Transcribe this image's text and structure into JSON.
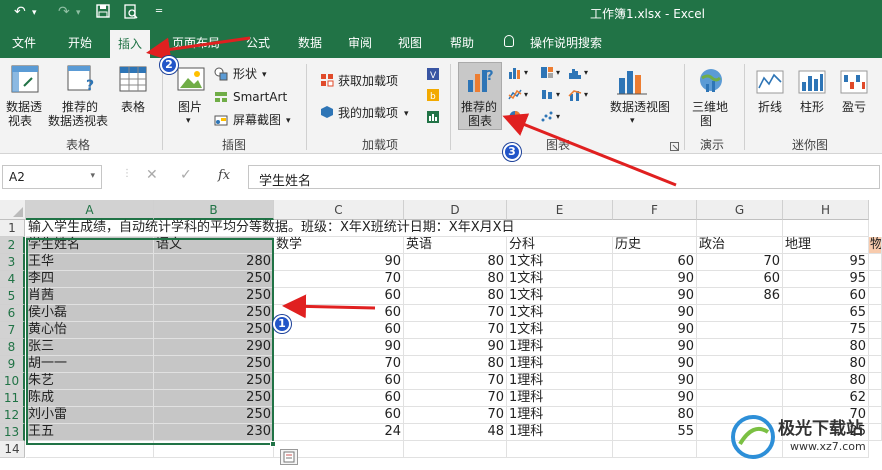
{
  "window": {
    "title": "工作簿1.xlsx  -  Excel"
  },
  "tabs": [
    "文件",
    "开始",
    "插入",
    "页面布局",
    "公式",
    "数据",
    "审阅",
    "视图",
    "帮助",
    "操作说明搜索"
  ],
  "ribbon": {
    "tables": {
      "pivot_label1": "数据透",
      "pivot_label2": "视表",
      "rec_pivot_label1": "推荐的",
      "rec_pivot_label2": "数据透视表",
      "table_label": "表格",
      "group": "表格"
    },
    "illustrations": {
      "pictures_label": "图片",
      "shapes_label": "形状",
      "smartart_label": "SmartArt",
      "screenshot_label": "屏幕截图",
      "group": "插图"
    },
    "addins": {
      "get_label": "获取加载项",
      "my_label": "我的加载项",
      "group": "加载项"
    },
    "charts": {
      "recommended_label1": "推荐的",
      "recommended_label2": "图表",
      "pivotchart_label": "数据透视图",
      "group": "图表"
    },
    "tours": {
      "map3d_label1": "三维地",
      "map3d_label2": "图",
      "group": "演示"
    },
    "sparklines": {
      "line_label": "折线",
      "column_label": "柱形",
      "winloss_label": "盈亏",
      "group": "迷你图"
    }
  },
  "formula_bar": {
    "name_box": "A2",
    "fx_label": "fx",
    "content": "学生姓名"
  },
  "grid": {
    "columns": [
      "A",
      "B",
      "C",
      "D",
      "E",
      "F",
      "G",
      "H"
    ],
    "rows": [
      "1",
      "2",
      "3",
      "4",
      "5",
      "6",
      "7",
      "8",
      "9",
      "10",
      "11",
      "12",
      "13",
      "14"
    ],
    "row1_text": "输入学生成绩，自动统计学科的平均分等数据。班级：X年X班统计日期：X年X月X日",
    "headers": [
      "学生姓名",
      "语文",
      "数学",
      "英语",
      "分科",
      "历史",
      "政治",
      "地理",
      "物"
    ],
    "data": [
      [
        "王华",
        "280",
        "90",
        "80",
        "1文科",
        "60",
        "70",
        "95"
      ],
      [
        "李四",
        "250",
        "70",
        "80",
        "1文科",
        "90",
        "60",
        "95"
      ],
      [
        "肖茜",
        "250",
        "60",
        "80",
        "1文科",
        "90",
        "86",
        "60"
      ],
      [
        "侯小磊",
        "250",
        "60",
        "70",
        "1文科",
        "90",
        "",
        "65"
      ],
      [
        "黄心怡",
        "250",
        "60",
        "70",
        "1文科",
        "90",
        "",
        "75"
      ],
      [
        "张三",
        "290",
        "90",
        "90",
        "1理科",
        "90",
        "",
        "80"
      ],
      [
        "胡一一",
        "250",
        "70",
        "80",
        "1理科",
        "90",
        "",
        "80"
      ],
      [
        "朱艺",
        "250",
        "60",
        "70",
        "1理科",
        "90",
        "",
        "80"
      ],
      [
        "陈成",
        "250",
        "60",
        "70",
        "1理科",
        "90",
        "",
        "62"
      ],
      [
        "刘小雷",
        "250",
        "60",
        "70",
        "1理科",
        "80",
        "",
        "70"
      ],
      [
        "王五",
        "230",
        "24",
        "48",
        "1理科",
        "55",
        "",
        "25"
      ]
    ]
  },
  "annotations": [
    "1",
    "2",
    "3"
  ],
  "watermark": {
    "line1": "极光下载站",
    "line2": "www.xz7.com"
  },
  "colors": {
    "excel_green": "#217346",
    "badge_blue": "#2255c8",
    "arrow_red": "#e02020"
  }
}
